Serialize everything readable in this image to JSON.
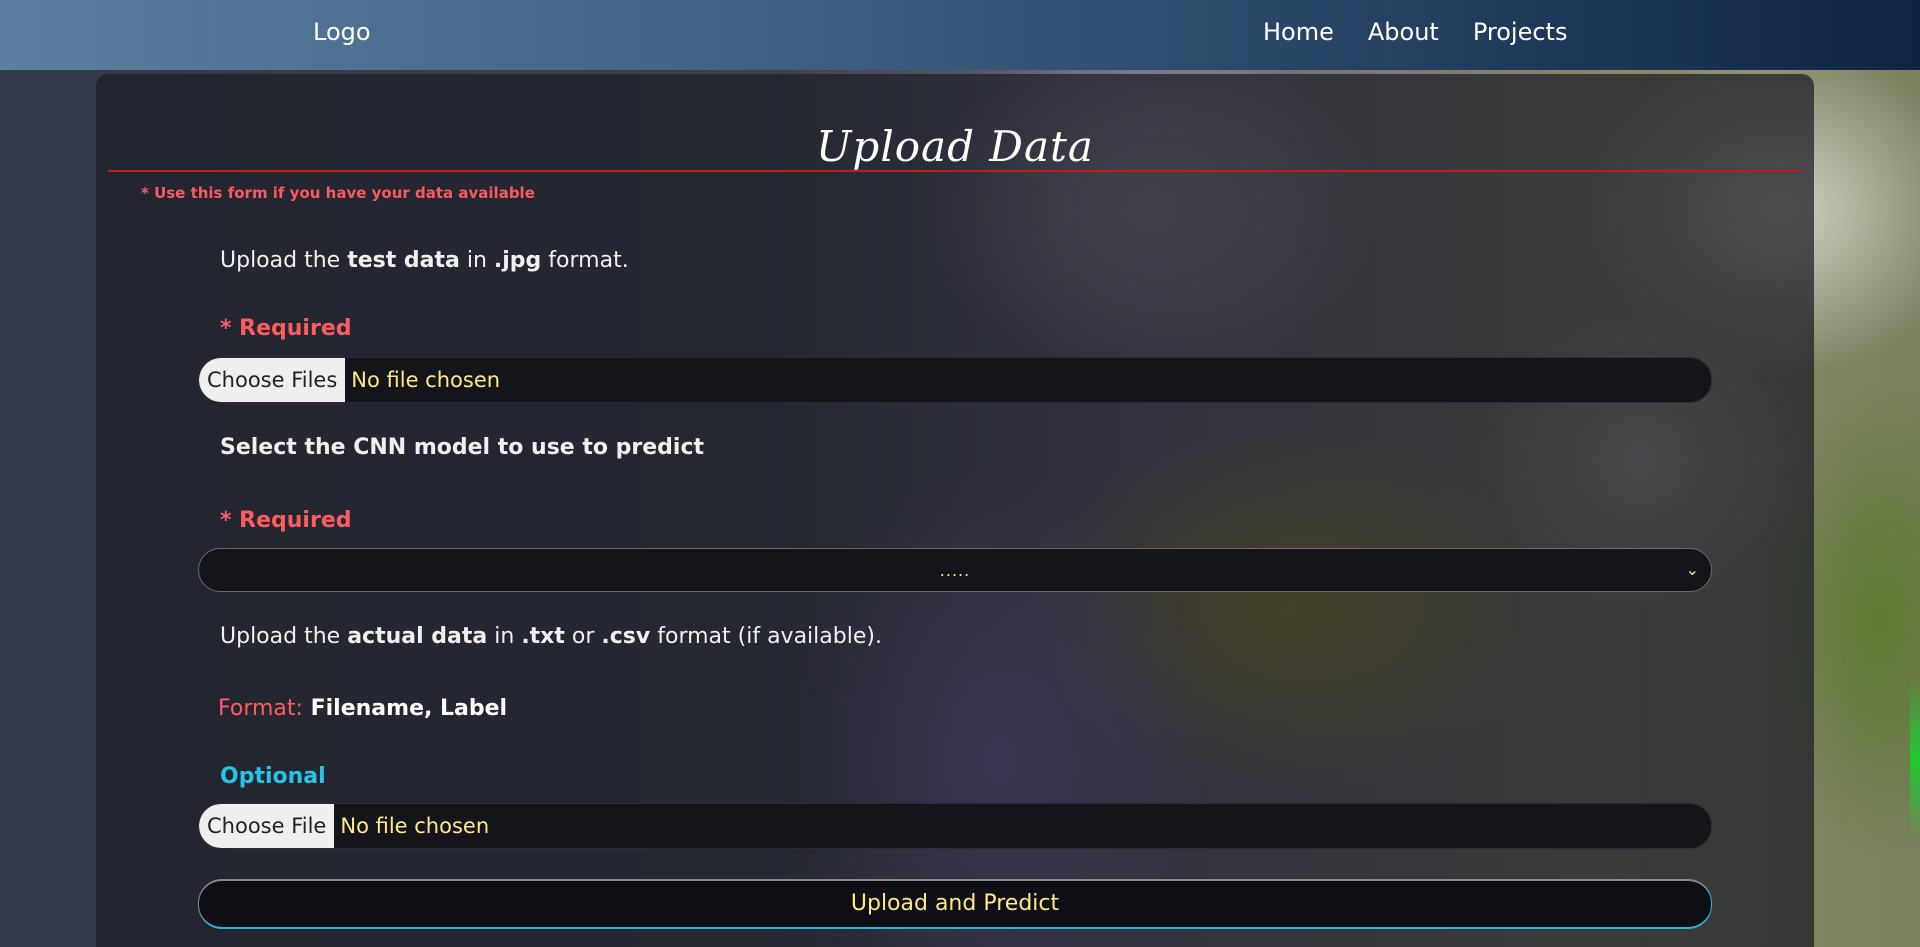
{
  "nav": {
    "logo": "Logo",
    "links": [
      "Home",
      "About",
      "Projects"
    ]
  },
  "form": {
    "title": "Upload Data",
    "note": "* Use this form if you have your data available",
    "test_data": {
      "prefix": "Upload the ",
      "bold1": "test data",
      "mid": " in ",
      "bold2": ".jpg",
      "suffix": " format.",
      "required": "* Required",
      "button": "Choose Files",
      "status": "No file chosen"
    },
    "model": {
      "label": "Select the CNN model to use to predict",
      "required": "* Required",
      "selected": "....."
    },
    "actual_data": {
      "prefix": "Upload the ",
      "bold1": "actual data",
      "mid1": " in ",
      "bold2": ".txt",
      "mid2": " or ",
      "bold3": ".csv",
      "suffix": " format (if available).",
      "format_label": "Format:",
      "format_value": " Filename, Label",
      "optional": "Optional",
      "button": "Choose File",
      "status": "No file chosen"
    },
    "submit": "Upload and Predict"
  },
  "colors": {
    "required": "#ff5d62",
    "optional": "#27c4e8",
    "accent_text": "#ffe98a",
    "title_rule": "#c8161c"
  },
  "icons": {
    "select_chevron": "chevron-down-icon"
  }
}
